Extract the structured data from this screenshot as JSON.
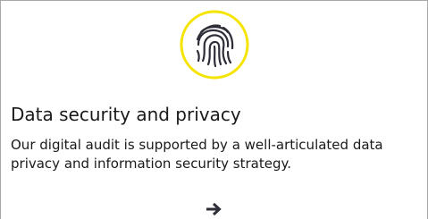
{
  "card": {
    "icon": "fingerprint-icon",
    "title": "Data security and privacy",
    "description": "Our digital audit is supported by a well-articulated data privacy and information security strategy.",
    "link_icon": "arrow-right-icon"
  },
  "colors": {
    "accent_ring": "#f5e300",
    "icon_stroke": "#2e2e38",
    "text": "#1a1a1a",
    "border": "#a8a8a8"
  }
}
